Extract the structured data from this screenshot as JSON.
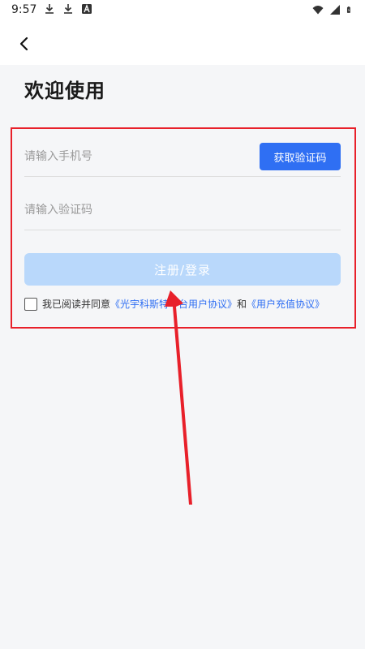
{
  "status_bar": {
    "time": "9:57",
    "left_icons": [
      "download-icon",
      "download-icon",
      "font-icon"
    ],
    "right_icons": [
      "wifi-icon",
      "signal-icon",
      "battery-icon"
    ]
  },
  "nav": {
    "back_icon": "chevron-left-icon"
  },
  "page": {
    "title": "欢迎使用"
  },
  "form": {
    "phone_placeholder": "请输入手机号",
    "get_code_label": "获取验证码",
    "code_placeholder": "请输入验证码",
    "submit_label": "注册/登录"
  },
  "agreement": {
    "prefix": "我已阅读并同意",
    "link1": "《光宇科斯特平台用户协议》",
    "conjunction": "和",
    "link2": "《用户充值协议》",
    "checked": false
  },
  "colors": {
    "accent": "#2f6ff3",
    "submit_disabled": "#b9d8fb",
    "annotation_red": "#e8202a",
    "background": "#f5f6f8"
  }
}
